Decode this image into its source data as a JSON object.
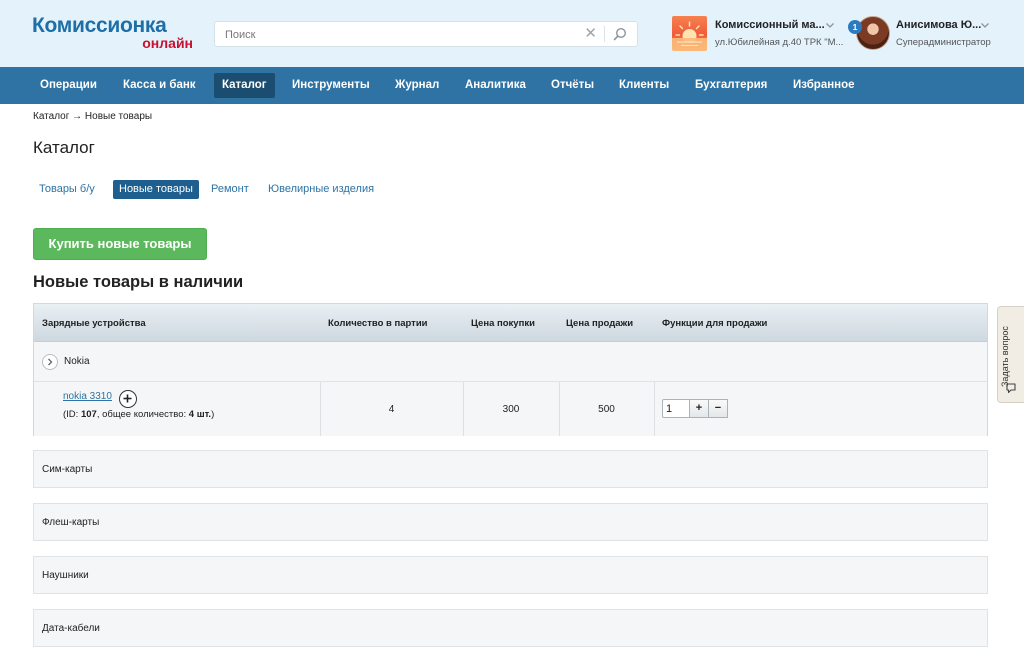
{
  "header": {
    "logo_main": "Комиссионка",
    "logo_sub": "онлайн",
    "search_placeholder": "Поиск",
    "store_name": "Комиссионный ма...",
    "store_address": "ул.Юбилейная д.40 ТРК \"М...",
    "notification_count": "1",
    "user_name": "Анисимова Ю...",
    "user_role": "Суперадминистратор"
  },
  "nav": {
    "items": [
      "Операции",
      "Касса и банк",
      "Каталог",
      "Инструменты",
      "Журнал",
      "Аналитика",
      "Отчёты",
      "Клиенты",
      "Бухгалтерия",
      "Избранное"
    ],
    "active": "Каталог"
  },
  "breadcrumb": "Каталог → Новые товары",
  "page_title": "Каталог",
  "tabs": {
    "items": [
      "Товары б/у",
      "Новые товары",
      "Ремонт",
      "Ювелирные изделия"
    ],
    "active": "Новые товары"
  },
  "buy_button": "Купить новые товары",
  "section_title": "Новые товары в наличии",
  "table": {
    "headers": [
      "Зарядные устройства",
      "Количество в партии",
      "Цена покупки",
      "Цена продажи",
      "Функции для продажи"
    ],
    "group": "Nokia",
    "item": {
      "name": "nokia 3310",
      "id_prefix": "(ID: ",
      "id": "107",
      "total_prefix": ",   общее количество: ",
      "total": "4 шт.",
      "suffix": ")",
      "quantity": "4",
      "purchase_price": "300",
      "sale_price": "500",
      "sell_qty": "1"
    }
  },
  "categories": [
    "Сим-карты",
    "Флеш-карты",
    "Наушники",
    "Дата-кабели"
  ],
  "side_widget": "Задать вопрос",
  "colors": {
    "header_bg": "#e3f2fb",
    "nav_bg": "#2e73a3",
    "nav_active": "#1b4d70",
    "accent": "#2e73a3",
    "buy_green": "#5cb85c",
    "logo_red": "#c8102e"
  }
}
